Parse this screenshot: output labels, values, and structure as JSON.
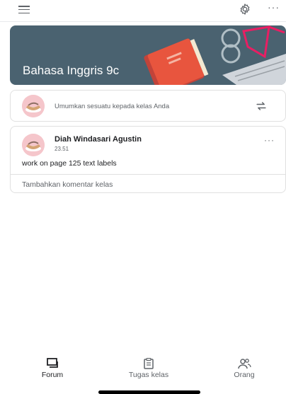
{
  "header": {
    "menu_icon": "hamburger-menu-icon",
    "settings_icon": "gear-icon",
    "more_icon": "more-horizontal-icon",
    "more_glyph": "···"
  },
  "banner": {
    "class_name": "Bahasa Inggris 9c",
    "background_color": "#4a6270"
  },
  "announce": {
    "avatar_icon": "avatar",
    "prompt": "Umumkan sesuatu kepada kelas Anda",
    "repost_icon": "repost-icon"
  },
  "post": {
    "author": "Diah Windasari Agustin",
    "time": "23.51",
    "body": "work on page 125 text labels",
    "more_glyph": "···",
    "comment_placeholder": "Tambahkan komentar kelas"
  },
  "bottom_nav": {
    "items": [
      {
        "label": "Forum",
        "icon": "forum-icon",
        "active": true
      },
      {
        "label": "Tugas kelas",
        "icon": "classwork-icon",
        "active": false
      },
      {
        "label": "Orang",
        "icon": "people-icon",
        "active": false
      }
    ]
  }
}
